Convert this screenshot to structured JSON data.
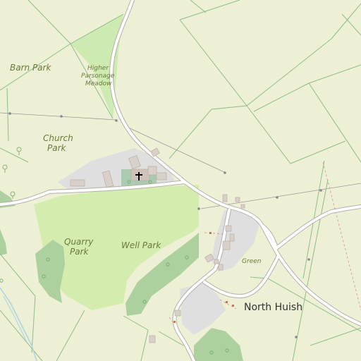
{
  "map": {
    "labels": {
      "barn_park": "Barn Park",
      "higher_parsonage_meadow_1": "Higher",
      "higher_parsonage_meadow_2": "Parsonage",
      "higher_parsonage_meadow_3": "Meadow",
      "church_park_1": "Church",
      "church_park_2": "Park",
      "quarry_park_1": "Quarry",
      "quarry_park_2": "Park",
      "well_park": "Well Park",
      "green": "Green",
      "north_huish": "North Huish"
    },
    "colors": {
      "farmland": "#eef0d5",
      "meadow": "#cdebb0",
      "grass": "#d4edaf",
      "wood": "#add19e",
      "residential": "#e0dfdf",
      "building": "#d9d0c9",
      "road": "#ffffff",
      "road_casing": "#b5b0aa",
      "field_boundary": "#8fbc8f",
      "water": "#aad3df",
      "path": "#fa8072"
    }
  }
}
